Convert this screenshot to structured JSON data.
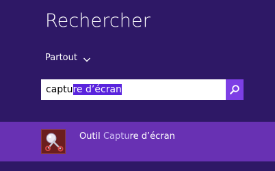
{
  "panel": {
    "title": "Rechercher",
    "scope_label": "Partout",
    "scope_icon": "chevron-down-icon"
  },
  "search": {
    "typed": "captu",
    "selected": "re d’écran",
    "button_icon": "search-icon"
  },
  "results": [
    {
      "prefix": "Outil ",
      "match": "Captu",
      "suffix": "re d’écran",
      "icon": "snipping-tool-icon"
    }
  ],
  "colors": {
    "background": "#2e1866",
    "selected_row": "#6831b3",
    "search_button": "#7d3fe5",
    "text_selection": "#5a24dd"
  }
}
